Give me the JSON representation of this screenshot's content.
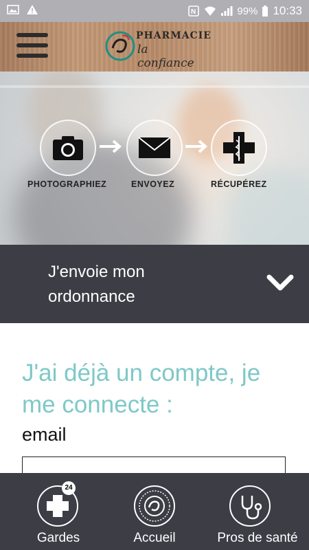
{
  "status_bar": {
    "battery": "99%",
    "time": "10:33",
    "icons_left": [
      "image-icon",
      "warning-icon"
    ],
    "icons_right": [
      "nfc-icon",
      "wifi-icon",
      "signal-icon",
      "battery-icon"
    ]
  },
  "header": {
    "logo_line1": "PHARMACIE",
    "logo_line2": "la confiance"
  },
  "hero": {
    "steps": [
      {
        "label": "PHOTOGRAPHIEZ",
        "icon": "camera-icon"
      },
      {
        "label": "ENVOYEZ",
        "icon": "envelope-icon"
      },
      {
        "label": "RÉCUPÉREZ",
        "icon": "pharmacy-cross-icon"
      }
    ]
  },
  "accordion": {
    "title_line1": "J'envoie mon",
    "title_line2": "ordonnance"
  },
  "login": {
    "title_line1": "J'ai déjà un compte, je",
    "title_line2": "me connecte :",
    "email_label": "email",
    "email_value": ""
  },
  "bottom_nav": {
    "items": [
      {
        "label": "Gardes",
        "icon": "cross-24-icon",
        "badge": "24"
      },
      {
        "label": "Accueil",
        "icon": "logo-icon"
      },
      {
        "label": "Pros de santé",
        "icon": "stethoscope-icon"
      }
    ]
  },
  "colors": {
    "accent": "#7fc8c8",
    "dark_bar": "#3c3d45",
    "status_bar": "#b0afb4"
  }
}
